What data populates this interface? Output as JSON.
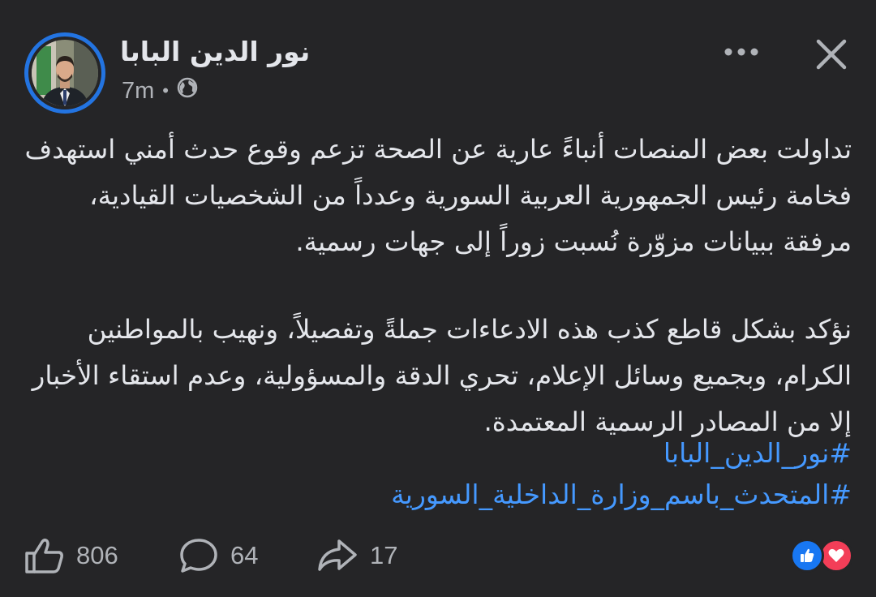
{
  "post": {
    "author": "نور الدين البابا",
    "time": "7m",
    "audience_icon": "globe-icon",
    "paragraphs": [
      "تداولت بعض المنصات أنباءً عارية عن الصحة تزعم وقوع حدث أمني استهدف فخامة رئيس الجمهورية العربية السورية وعدداً من الشخصيات القيادية، مرفقة ببيانات مزوّرة نُسبت زوراً إلى جهات رسمية.",
      "نؤكد بشكل قاطع كذب هذه الادعاءات جملةً وتفصيلاً، ونهيب بالمواطنين الكرام، وبجميع وسائل الإعلام، تحري الدقة والمسؤولية، وعدم استقاء الأخبار إلا من المصادر الرسمية المعتمدة."
    ],
    "hashtags": [
      "#نور_الدين_البابا",
      "#المتحدث_باسم_وزارة_الداخلية_السورية"
    ]
  },
  "header": {
    "more_icon": "more-horizontal-icon",
    "close_icon": "close-icon"
  },
  "footer": {
    "likes": "806",
    "comments": "64",
    "shares": "17",
    "reactions": [
      "like",
      "love"
    ]
  },
  "colors": {
    "background": "#252527",
    "text": "#e4e6eb",
    "secondary_text": "#b0b3b8",
    "hashtag": "#4599ff",
    "accent": "#2374e1",
    "love": "#f33e58",
    "like": "#1877f2"
  }
}
